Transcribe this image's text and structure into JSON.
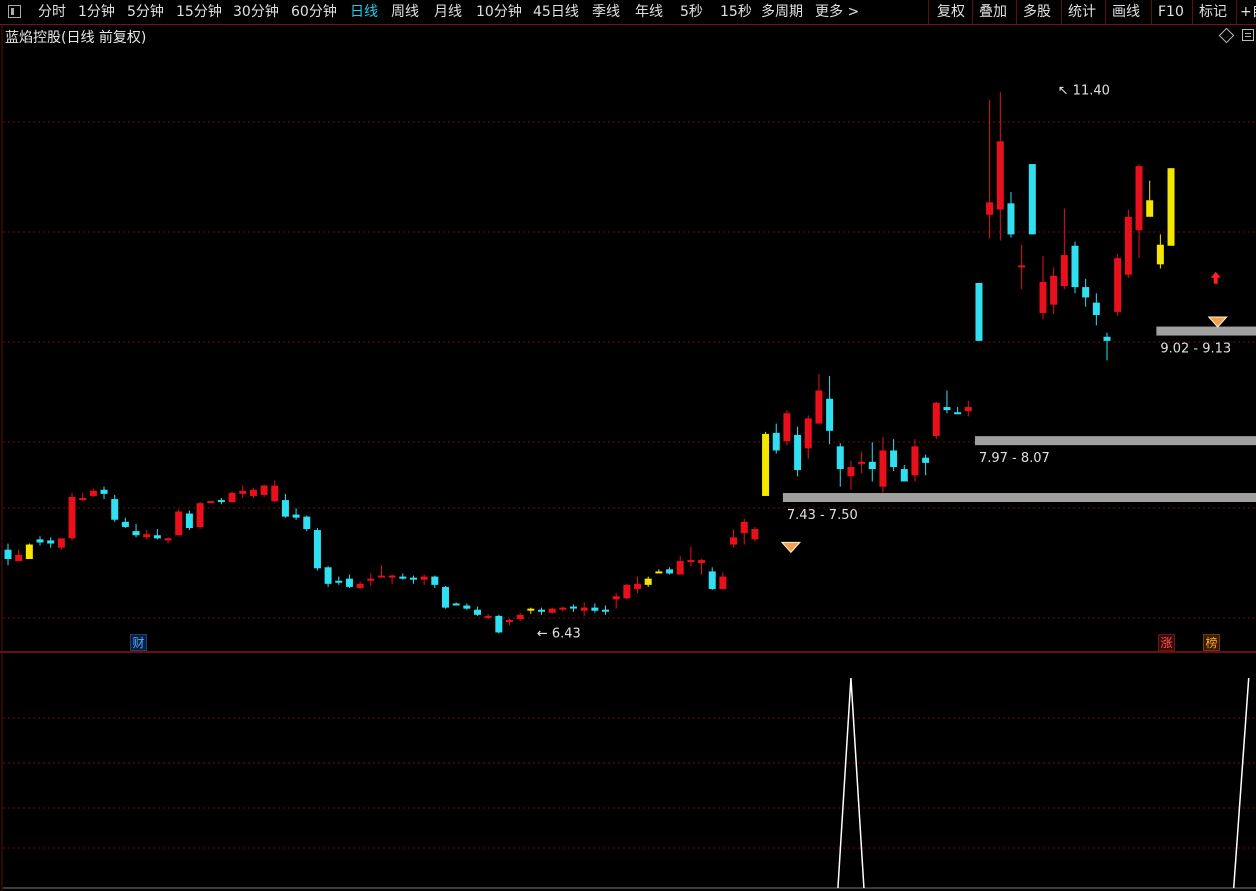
{
  "toolbar": {
    "periods": [
      "分时",
      "1分钟",
      "5分钟",
      "15分钟",
      "30分钟",
      "60分钟",
      "日线",
      "周线",
      "月线",
      "10分钟",
      "45日线",
      "季线",
      "年线",
      "5秒",
      "15秒",
      "多周期",
      "更多 >"
    ],
    "active_period": "日线",
    "tools": [
      "复权",
      "叠加",
      "多股",
      "统计",
      "画线",
      "F10",
      "标记",
      "+自"
    ]
  },
  "chart": {
    "title": "蓝焰控股(日线 前复权)",
    "high_label": "11.40",
    "low_label": "6.43",
    "zones": [
      "7.43 - 7.50",
      "7.97 - 8.07",
      "9.02 - 9.13"
    ],
    "badges": {
      "cai": "财",
      "zhang": "涨",
      "bang": "榜"
    },
    "icons": [
      "diamond-icon",
      "box-icon",
      "gem-icon",
      "gem-icon",
      "red-up-arrow-icon"
    ]
  },
  "colors": {
    "up": "#e8101a",
    "down": "#30e0f0",
    "special": "#f5e600",
    "grid": "#6a0f0f",
    "zone": "#a0a0a0",
    "indicator": "#ffffff"
  },
  "chart_data": {
    "type": "candlestick",
    "price_range": [
      6.0,
      11.9
    ],
    "candles": [
      {
        "o": 6.97,
        "h": 7.03,
        "l": 6.82,
        "c": 6.88,
        "k": "down"
      },
      {
        "o": 6.92,
        "h": 6.97,
        "l": 6.88,
        "c": 6.86,
        "k": "up"
      },
      {
        "o": 6.88,
        "h": 7.03,
        "l": 6.88,
        "c": 7.02,
        "k": "yellow"
      },
      {
        "o": 7.04,
        "h": 7.1,
        "l": 7.01,
        "c": 7.07,
        "k": "down"
      },
      {
        "o": 7.03,
        "h": 7.09,
        "l": 6.99,
        "c": 7.06,
        "k": "down"
      },
      {
        "o": 6.99,
        "h": 7.07,
        "l": 6.97,
        "c": 7.08,
        "k": "up"
      },
      {
        "o": 7.08,
        "h": 7.52,
        "l": 7.06,
        "c": 7.48,
        "k": "up"
      },
      {
        "o": 7.47,
        "h": 7.52,
        "l": 7.44,
        "c": 7.45,
        "k": "up"
      },
      {
        "o": 7.49,
        "h": 7.56,
        "l": 7.48,
        "c": 7.54,
        "k": "up"
      },
      {
        "o": 7.55,
        "h": 7.58,
        "l": 7.46,
        "c": 7.51,
        "k": "down"
      },
      {
        "o": 7.46,
        "h": 7.5,
        "l": 7.24,
        "c": 7.26,
        "k": "down"
      },
      {
        "o": 7.24,
        "h": 7.28,
        "l": 7.18,
        "c": 7.19,
        "k": "down"
      },
      {
        "o": 7.15,
        "h": 7.22,
        "l": 7.09,
        "c": 7.11,
        "k": "down"
      },
      {
        "o": 7.09,
        "h": 7.16,
        "l": 7.07,
        "c": 7.12,
        "k": "up"
      },
      {
        "o": 7.11,
        "h": 7.17,
        "l": 7.07,
        "c": 7.08,
        "k": "down"
      },
      {
        "o": 7.08,
        "h": 7.09,
        "l": 7.03,
        "c": 7.06,
        "k": "up"
      },
      {
        "o": 7.11,
        "h": 7.36,
        "l": 7.11,
        "c": 7.34,
        "k": "up"
      },
      {
        "o": 7.32,
        "h": 7.35,
        "l": 7.16,
        "c": 7.18,
        "k": "down"
      },
      {
        "o": 7.19,
        "h": 7.43,
        "l": 7.17,
        "c": 7.42,
        "k": "up"
      },
      {
        "o": 7.43,
        "h": 7.44,
        "l": 7.43,
        "c": 7.44,
        "k": "up"
      },
      {
        "o": 7.44,
        "h": 7.47,
        "l": 7.41,
        "c": 7.45,
        "k": "down"
      },
      {
        "o": 7.43,
        "h": 7.53,
        "l": 7.43,
        "c": 7.52,
        "k": "up"
      },
      {
        "o": 7.51,
        "h": 7.59,
        "l": 7.47,
        "c": 7.54,
        "k": "up"
      },
      {
        "o": 7.55,
        "h": 7.57,
        "l": 7.47,
        "c": 7.49,
        "k": "up"
      },
      {
        "o": 7.5,
        "h": 7.6,
        "l": 7.48,
        "c": 7.59,
        "k": "up"
      },
      {
        "o": 7.59,
        "h": 7.64,
        "l": 7.43,
        "c": 7.44,
        "k": "up"
      },
      {
        "o": 7.45,
        "h": 7.51,
        "l": 7.28,
        "c": 7.29,
        "k": "down"
      },
      {
        "o": 7.31,
        "h": 7.37,
        "l": 7.26,
        "c": 7.28,
        "k": "down"
      },
      {
        "o": 7.29,
        "h": 7.3,
        "l": 7.15,
        "c": 7.17,
        "k": "down"
      },
      {
        "o": 7.16,
        "h": 7.18,
        "l": 6.77,
        "c": 6.79,
        "k": "down"
      },
      {
        "o": 6.8,
        "h": 6.81,
        "l": 6.61,
        "c": 6.64,
        "k": "down"
      },
      {
        "o": 6.66,
        "h": 6.71,
        "l": 6.63,
        "c": 6.67,
        "k": "down"
      },
      {
        "o": 6.69,
        "h": 6.73,
        "l": 6.6,
        "c": 6.61,
        "k": "down"
      },
      {
        "o": 6.6,
        "h": 6.66,
        "l": 6.59,
        "c": 6.64,
        "k": "up"
      },
      {
        "o": 6.67,
        "h": 6.74,
        "l": 6.62,
        "c": 6.69,
        "k": "up"
      },
      {
        "o": 6.71,
        "h": 6.82,
        "l": 6.71,
        "c": 6.72,
        "k": "up"
      },
      {
        "o": 6.72,
        "h": 6.73,
        "l": 6.64,
        "c": 6.71,
        "k": "up"
      },
      {
        "o": 6.71,
        "h": 6.74,
        "l": 6.68,
        "c": 6.69,
        "k": "down"
      },
      {
        "o": 6.7,
        "h": 6.72,
        "l": 6.64,
        "c": 6.68,
        "k": "down"
      },
      {
        "o": 6.68,
        "h": 6.73,
        "l": 6.63,
        "c": 6.71,
        "k": "up"
      },
      {
        "o": 6.71,
        "h": 6.72,
        "l": 6.6,
        "c": 6.63,
        "k": "down"
      },
      {
        "o": 6.61,
        "h": 6.62,
        "l": 6.4,
        "c": 6.41,
        "k": "down"
      },
      {
        "o": 6.44,
        "h": 6.46,
        "l": 6.43,
        "c": 6.45,
        "k": "down"
      },
      {
        "o": 6.43,
        "h": 6.45,
        "l": 6.39,
        "c": 6.4,
        "k": "down"
      },
      {
        "o": 6.39,
        "h": 6.42,
        "l": 6.33,
        "c": 6.34,
        "k": "down"
      },
      {
        "o": 6.33,
        "h": 6.35,
        "l": 6.3,
        "c": 6.32,
        "k": "up"
      },
      {
        "o": 6.33,
        "h": 6.34,
        "l": 6.16,
        "c": 6.17,
        "k": "down"
      },
      {
        "o": 6.27,
        "h": 6.3,
        "l": 6.24,
        "c": 6.29,
        "k": "up"
      },
      {
        "o": 6.3,
        "h": 6.36,
        "l": 6.28,
        "c": 6.34,
        "k": "up"
      },
      {
        "o": 6.38,
        "h": 6.41,
        "l": 6.35,
        "c": 6.4,
        "k": "yellow"
      },
      {
        "o": 6.39,
        "h": 6.41,
        "l": 6.34,
        "c": 6.37,
        "k": "down"
      },
      {
        "o": 6.36,
        "h": 6.41,
        "l": 6.35,
        "c": 6.4,
        "k": "up"
      },
      {
        "o": 6.39,
        "h": 6.42,
        "l": 6.37,
        "c": 6.41,
        "k": "up"
      },
      {
        "o": 6.41,
        "h": 6.44,
        "l": 6.37,
        "c": 6.42,
        "k": "down"
      },
      {
        "o": 6.38,
        "h": 6.46,
        "l": 6.33,
        "c": 6.41,
        "k": "up"
      },
      {
        "o": 6.41,
        "h": 6.45,
        "l": 6.36,
        "c": 6.38,
        "k": "down"
      },
      {
        "o": 6.39,
        "h": 6.43,
        "l": 6.34,
        "c": 6.37,
        "k": "down"
      },
      {
        "o": 6.49,
        "h": 6.55,
        "l": 6.4,
        "c": 6.52,
        "k": "up"
      },
      {
        "o": 6.5,
        "h": 6.64,
        "l": 6.49,
        "c": 6.63,
        "k": "up"
      },
      {
        "o": 6.59,
        "h": 6.71,
        "l": 6.55,
        "c": 6.64,
        "k": "up"
      },
      {
        "o": 6.63,
        "h": 6.71,
        "l": 6.61,
        "c": 6.69,
        "k": "yellow"
      },
      {
        "o": 6.75,
        "h": 6.78,
        "l": 6.75,
        "c": 6.76,
        "k": "yellow"
      },
      {
        "o": 6.78,
        "h": 6.8,
        "l": 6.73,
        "c": 6.74,
        "k": "down"
      },
      {
        "o": 6.73,
        "h": 6.91,
        "l": 6.73,
        "c": 6.86,
        "k": "up"
      },
      {
        "o": 6.86,
        "h": 7.0,
        "l": 6.81,
        "c": 6.87,
        "k": "up"
      },
      {
        "o": 6.87,
        "h": 6.88,
        "l": 6.73,
        "c": 6.84,
        "k": "up"
      },
      {
        "o": 6.76,
        "h": 6.8,
        "l": 6.58,
        "c": 6.59,
        "k": "down"
      },
      {
        "o": 6.59,
        "h": 6.75,
        "l": 6.59,
        "c": 6.71,
        "k": "up"
      },
      {
        "o": 7.02,
        "h": 7.17,
        "l": 6.99,
        "c": 7.09,
        "k": "up"
      },
      {
        "o": 7.13,
        "h": 7.27,
        "l": 7.02,
        "c": 7.24,
        "k": "up"
      },
      {
        "o": 7.07,
        "h": 7.19,
        "l": 7.05,
        "c": 7.17,
        "k": "up"
      },
      {
        "o": 7.49,
        "h": 8.11,
        "l": 7.49,
        "c": 8.09,
        "k": "yellow"
      },
      {
        "o": 8.1,
        "h": 8.19,
        "l": 7.9,
        "c": 7.93,
        "k": "down"
      },
      {
        "o": 8.02,
        "h": 8.32,
        "l": 7.98,
        "c": 8.29,
        "k": "up"
      },
      {
        "o": 8.08,
        "h": 8.16,
        "l": 7.68,
        "c": 7.74,
        "k": "down"
      },
      {
        "o": 7.95,
        "h": 8.27,
        "l": 7.85,
        "c": 8.24,
        "k": "up"
      },
      {
        "o": 8.19,
        "h": 8.67,
        "l": 8.19,
        "c": 8.51,
        "k": "up"
      },
      {
        "o": 8.43,
        "h": 8.65,
        "l": 7.99,
        "c": 8.12,
        "k": "down"
      },
      {
        "o": 7.97,
        "h": 8.0,
        "l": 7.58,
        "c": 7.75,
        "k": "down"
      },
      {
        "o": 7.77,
        "h": 7.83,
        "l": 7.55,
        "c": 7.68,
        "k": "up"
      },
      {
        "o": 7.81,
        "h": 7.92,
        "l": 7.71,
        "c": 7.82,
        "k": "up"
      },
      {
        "o": 7.82,
        "h": 8.01,
        "l": 7.63,
        "c": 7.75,
        "k": "down"
      },
      {
        "o": 7.93,
        "h": 8.06,
        "l": 7.52,
        "c": 7.58,
        "k": "up"
      },
      {
        "o": 7.93,
        "h": 8.04,
        "l": 7.73,
        "c": 7.77,
        "k": "down"
      },
      {
        "o": 7.63,
        "h": 7.79,
        "l": 7.63,
        "c": 7.75,
        "k": "down"
      },
      {
        "o": 7.97,
        "h": 8.04,
        "l": 7.63,
        "c": 7.69,
        "k": "up"
      },
      {
        "o": 7.81,
        "h": 7.89,
        "l": 7.69,
        "c": 7.86,
        "k": "down"
      },
      {
        "o": 8.07,
        "h": 8.4,
        "l": 8.04,
        "c": 8.39,
        "k": "up"
      },
      {
        "o": 8.35,
        "h": 8.51,
        "l": 8.29,
        "c": 8.32,
        "k": "down"
      },
      {
        "o": 8.3,
        "h": 8.35,
        "l": 8.29,
        "c": 8.28,
        "k": "down"
      },
      {
        "o": 8.31,
        "h": 8.41,
        "l": 8.26,
        "c": 8.35,
        "k": "up"
      },
      {
        "o": 8.99,
        "h": 9.55,
        "l": 8.99,
        "c": 9.55,
        "k": "down"
      },
      {
        "o": 10.33,
        "h": 11.32,
        "l": 9.98,
        "c": 10.21,
        "k": "up"
      },
      {
        "o": 10.26,
        "h": 11.4,
        "l": 9.96,
        "c": 10.92,
        "k": "up"
      },
      {
        "o": 10.32,
        "h": 10.43,
        "l": 9.99,
        "c": 10.02,
        "k": "down"
      },
      {
        "o": 9.72,
        "h": 9.92,
        "l": 9.49,
        "c": 9.72,
        "k": "up"
      },
      {
        "o": 10.7,
        "h": 10.7,
        "l": 10.02,
        "c": 10.02,
        "k": "down"
      },
      {
        "o": 9.56,
        "h": 9.81,
        "l": 9.2,
        "c": 9.26,
        "k": "up"
      },
      {
        "o": 9.34,
        "h": 9.7,
        "l": 9.25,
        "c": 9.62,
        "k": "up"
      },
      {
        "o": 9.52,
        "h": 10.27,
        "l": 9.49,
        "c": 9.82,
        "k": "up"
      },
      {
        "o": 9.91,
        "h": 9.95,
        "l": 9.45,
        "c": 9.51,
        "k": "down"
      },
      {
        "o": 9.51,
        "h": 9.59,
        "l": 9.32,
        "c": 9.41,
        "k": "down"
      },
      {
        "o": 9.36,
        "h": 9.45,
        "l": 9.14,
        "c": 9.24,
        "k": "down"
      },
      {
        "o": 9.03,
        "h": 9.07,
        "l": 8.8,
        "c": 8.99,
        "k": "down"
      },
      {
        "o": 9.27,
        "h": 9.83,
        "l": 9.23,
        "c": 9.79,
        "k": "up"
      },
      {
        "o": 9.63,
        "h": 10.26,
        "l": 9.6,
        "c": 10.19,
        "k": "up"
      },
      {
        "o": 10.06,
        "h": 10.7,
        "l": 9.79,
        "c": 10.68,
        "k": "up"
      },
      {
        "o": 10.35,
        "h": 10.54,
        "l": 10.35,
        "c": 10.19,
        "k": "yellow"
      },
      {
        "o": 9.92,
        "h": 10.02,
        "l": 9.69,
        "c": 9.73,
        "k": "yellow"
      },
      {
        "o": 9.91,
        "h": 10.66,
        "l": 9.91,
        "c": 10.66,
        "k": "yellow"
      }
    ],
    "annotations": [
      "11.40",
      "6.43",
      "7.43 - 7.50",
      "7.97 - 8.07",
      "9.02 - 9.13"
    ],
    "indicator_peaks": [
      79,
      116
    ]
  }
}
